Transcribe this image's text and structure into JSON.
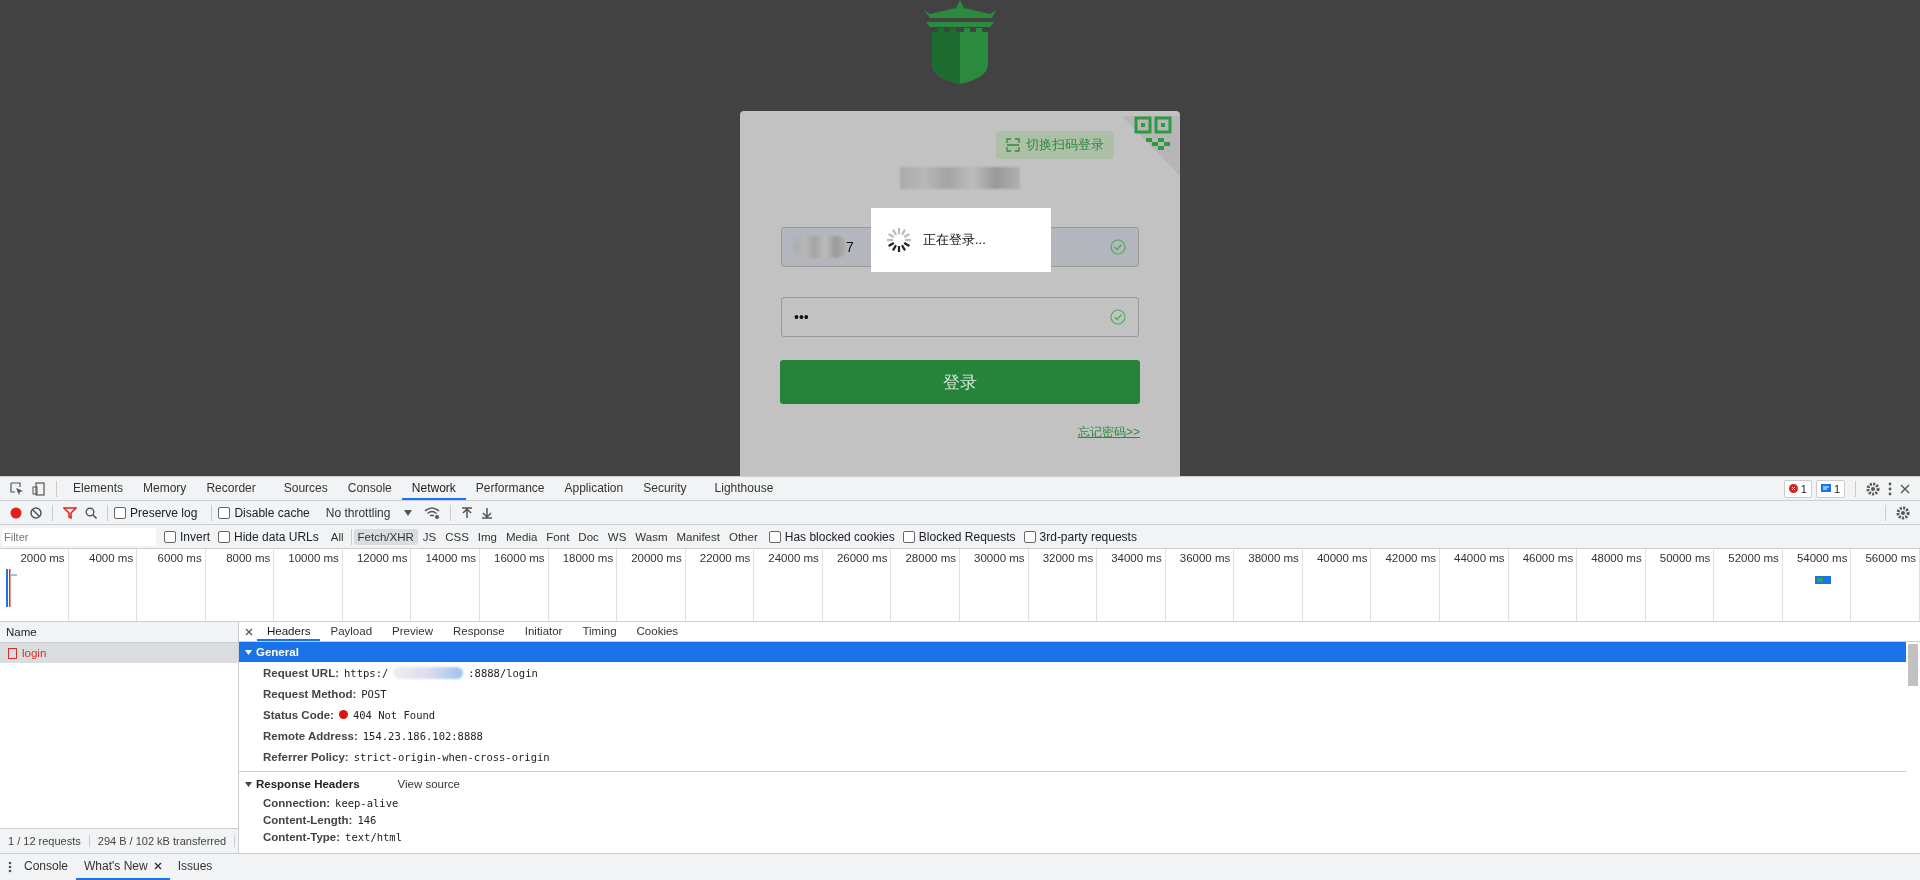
{
  "page": {
    "qr_switch_label": "切换扫码登录",
    "username_value": "7",
    "password_value": "•••",
    "login_button": "登录",
    "forgot_link": "忘记密码>>",
    "loading_text": "正在登录..."
  },
  "devtools": {
    "tabs": [
      {
        "label": "Elements",
        "selected": false
      },
      {
        "label": "Memory",
        "selected": false
      },
      {
        "label": "Recorder",
        "selected": false
      },
      {
        "label": "Sources",
        "selected": false
      },
      {
        "label": "Console",
        "selected": false
      },
      {
        "label": "Network",
        "selected": true
      },
      {
        "label": "Performance",
        "selected": false
      },
      {
        "label": "Application",
        "selected": false
      },
      {
        "label": "Security",
        "selected": false
      },
      {
        "label": "Lighthouse",
        "selected": false
      }
    ],
    "badges": [
      {
        "kind": "error",
        "count": "1"
      },
      {
        "kind": "info",
        "count": "1"
      }
    ],
    "toolbar": {
      "recording": true,
      "filter_active": true,
      "checks": [
        {
          "label": "Preserve log",
          "checked": false
        },
        {
          "label": "Disable cache",
          "checked": false
        }
      ],
      "throttling": "No throttling"
    },
    "filter": {
      "placeholder": "Filter",
      "checks": [
        {
          "label": "Invert",
          "checked": false
        },
        {
          "label": "Hide data URLs",
          "checked": false
        }
      ],
      "types": [
        {
          "label": "All",
          "selected": false
        },
        {
          "label": "Fetch/XHR",
          "selected": true
        },
        {
          "label": "JS",
          "selected": false
        },
        {
          "label": "CSS",
          "selected": false
        },
        {
          "label": "Img",
          "selected": false
        },
        {
          "label": "Media",
          "selected": false
        },
        {
          "label": "Font",
          "selected": false
        },
        {
          "label": "Doc",
          "selected": false
        },
        {
          "label": "WS",
          "selected": false
        },
        {
          "label": "Wasm",
          "selected": false
        },
        {
          "label": "Manifest",
          "selected": false
        },
        {
          "label": "Other",
          "selected": false
        }
      ],
      "more_checks": [
        {
          "label": "Has blocked cookies",
          "checked": false
        },
        {
          "label": "Blocked Requests",
          "checked": false
        },
        {
          "label": "3rd-party requests",
          "checked": false
        }
      ]
    },
    "timeline": {
      "ticks": [
        "2000 ms",
        "4000 ms",
        "6000 ms",
        "8000 ms",
        "10000 ms",
        "12000 ms",
        "14000 ms",
        "16000 ms",
        "18000 ms",
        "20000 ms",
        "22000 ms",
        "24000 ms",
        "26000 ms",
        "28000 ms",
        "30000 ms",
        "32000 ms",
        "34000 ms",
        "36000 ms",
        "38000 ms",
        "40000 ms",
        "42000 ms",
        "44000 ms",
        "46000 ms",
        "48000 ms",
        "50000 ms",
        "52000 ms",
        "54000 ms",
        "56000 ms"
      ]
    },
    "requests": {
      "column": "Name",
      "rows": [
        {
          "name": "login",
          "selected": true,
          "failed": true
        }
      ]
    },
    "status": [
      "1 / 12 requests",
      "294 B / 102 kB transferred"
    ],
    "detail_tabs": [
      {
        "label": "Headers",
        "selected": true
      },
      {
        "label": "Payload",
        "selected": false
      },
      {
        "label": "Preview",
        "selected": false
      },
      {
        "label": "Response",
        "selected": false
      },
      {
        "label": "Initiator",
        "selected": false
      },
      {
        "label": "Timing",
        "selected": false
      },
      {
        "label": "Cookies",
        "selected": false
      }
    ],
    "sections": [
      {
        "title": "General",
        "highlighted": true,
        "rows": [
          {
            "kind": "redacted",
            "label": "Request URL:",
            "value_prefix": "https:/",
            "value_suffix": ":8888/login"
          },
          {
            "kind": "plain",
            "label": "Request Method:",
            "value": "POST"
          },
          {
            "kind": "status",
            "label": "Status Code:",
            "value": "404 Not Found",
            "color": "#e01010"
          },
          {
            "kind": "plain",
            "label": "Remote Address:",
            "value": "154.23.186.102:8888"
          },
          {
            "kind": "plain",
            "label": "Referrer Policy:",
            "value": "strict-origin-when-cross-origin"
          }
        ]
      },
      {
        "title": "Response Headers",
        "highlighted": false,
        "link": "View source",
        "rows": [
          {
            "kind": "plain",
            "label": "Connection:",
            "value": "keep-alive"
          },
          {
            "kind": "plain",
            "label": "Content-Length:",
            "value": "146"
          },
          {
            "kind": "plain",
            "label": "Content-Type:",
            "value": "text/html"
          }
        ]
      }
    ],
    "drawer_tabs": [
      {
        "label": "Console",
        "selected": false,
        "closable": false
      },
      {
        "label": "What's New",
        "selected": true,
        "closable": true
      },
      {
        "label": "Issues",
        "selected": false,
        "closable": false
      }
    ]
  }
}
